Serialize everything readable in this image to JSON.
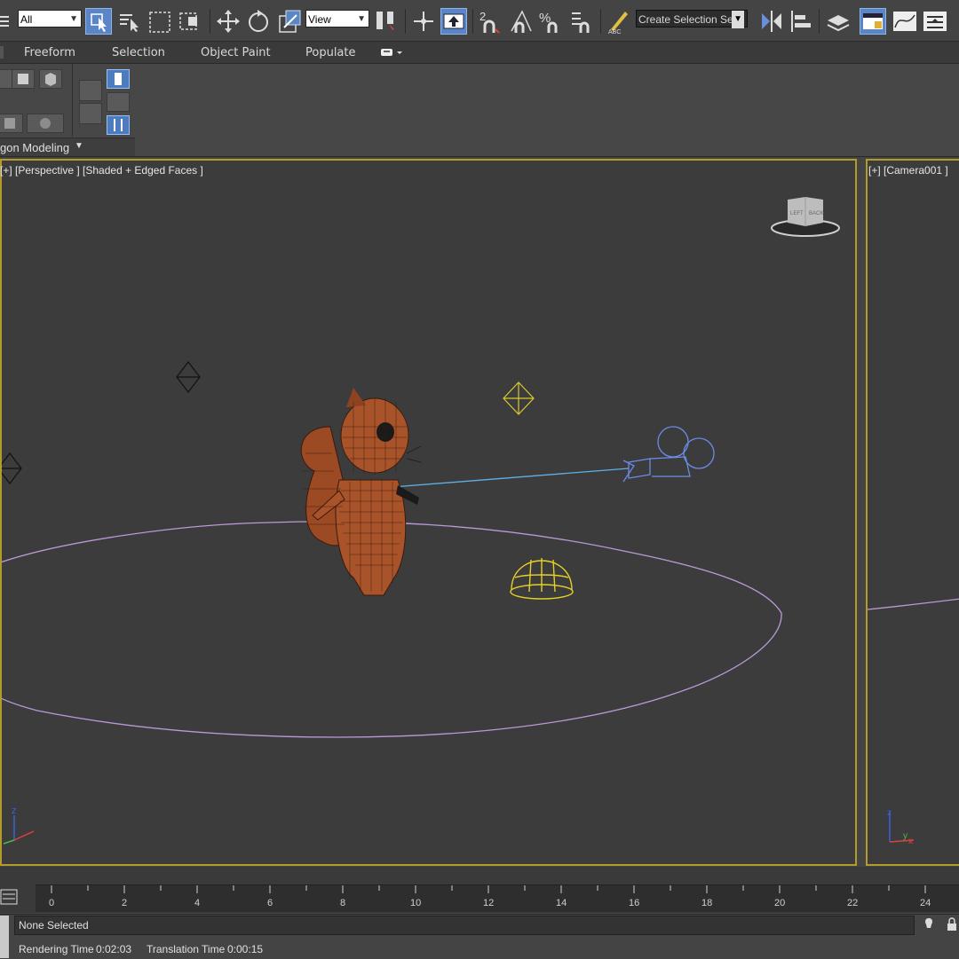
{
  "toolbar": {
    "selection_filter": "All",
    "reference_coordinate_system": "View",
    "named_selection_placeholder": "Create Selection Se",
    "icons": [
      "undo-icon",
      "select-object-icon",
      "select-by-name-icon",
      "rectangular-selection-icon",
      "window-crossing-icon",
      "move-icon",
      "rotate-icon",
      "scale-icon",
      "pivot-icon",
      "select-manipulate-icon",
      "keyboard-shortcut-override-icon",
      "snaps-toggle-icon",
      "angle-snap-icon",
      "percent-snap-icon",
      "spinner-snap-icon",
      "edit-named-selections-icon",
      "mirror-icon",
      "align-icon",
      "layer-explorer-icon",
      "toggle-ribbon-icon",
      "curve-editor-icon",
      "schematic-view-icon"
    ]
  },
  "ribbon": {
    "tabs": [
      "Freeform",
      "Selection",
      "Object Paint",
      "Populate"
    ],
    "panel_label": "gon Modeling"
  },
  "viewports": {
    "perspective_label": "[+] [Perspective ] [Shaded + Edged Faces ]",
    "camera_label": "[+] [Camera001 ]",
    "viewcube_left": "LEFT",
    "viewcube_back": "BACK",
    "axis_z": "z",
    "axis_x": "x",
    "axis_y": "y"
  },
  "timeline": {
    "ticks": [
      "0",
      "2",
      "4",
      "6",
      "8",
      "10",
      "12",
      "14",
      "16",
      "18",
      "20",
      "22",
      "24"
    ]
  },
  "status": {
    "selection": "None Selected",
    "rendering_time_label": "Rendering Time",
    "rendering_time_value": "0:02:03",
    "translation_time_label": "Translation Time",
    "translation_time_value": "0:00:15"
  },
  "colors": {
    "viewport_border": "#b49b2a",
    "active_button": "#5a86c8",
    "grid_circle": "#b89ad8",
    "light_helper": "#d8c830",
    "camera_blue": "#6b8ce8",
    "squirrel_fur": "#a8532a"
  }
}
